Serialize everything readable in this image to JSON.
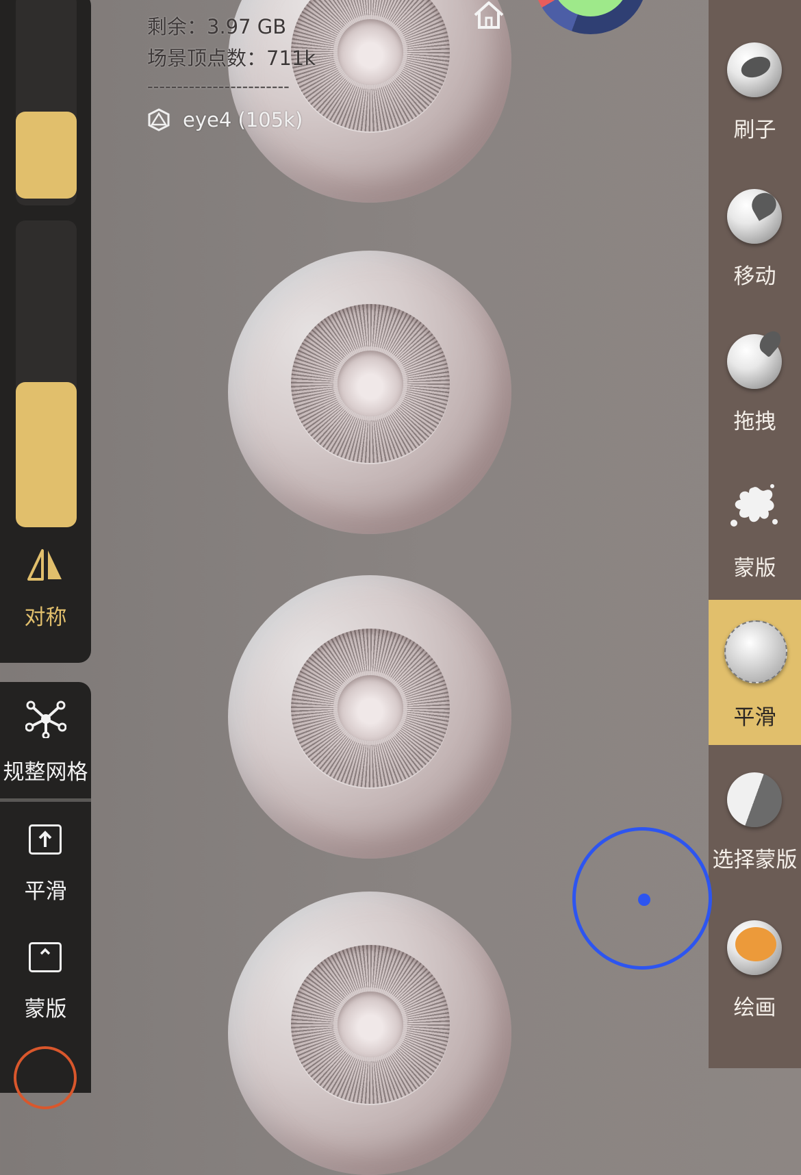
{
  "overlay": {
    "remaining": "剩余：3.97 GB",
    "scene_vertices": "场景顶点数：711k",
    "separator": "------------------------",
    "mesh_name": "eye4 (105k)"
  },
  "left_panel": {
    "symmetry_label": "对称",
    "regular_mesh_label": "规整网格",
    "smooth_label": "平滑",
    "mask_label": "蒙版"
  },
  "right_tools": [
    {
      "label": "刷子",
      "icon": "brush-tool-icon",
      "active": false
    },
    {
      "label": "移动",
      "icon": "move-tool-icon",
      "active": false
    },
    {
      "label": "拖拽",
      "icon": "drag-tool-icon",
      "active": false
    },
    {
      "label": "蒙版",
      "icon": "mask-splat-icon",
      "active": false
    },
    {
      "label": "平滑",
      "icon": "smooth-tool-icon",
      "active": true
    },
    {
      "label": "选择蒙版",
      "icon": "select-mask-icon",
      "active": false
    },
    {
      "label": "绘画",
      "icon": "paint-tool-icon",
      "active": false
    }
  ],
  "colors": {
    "accent": "#e1bf6c",
    "panel_dark": "#232221",
    "panel_right": "#6b5c55",
    "cursor": "#2d55f0"
  }
}
